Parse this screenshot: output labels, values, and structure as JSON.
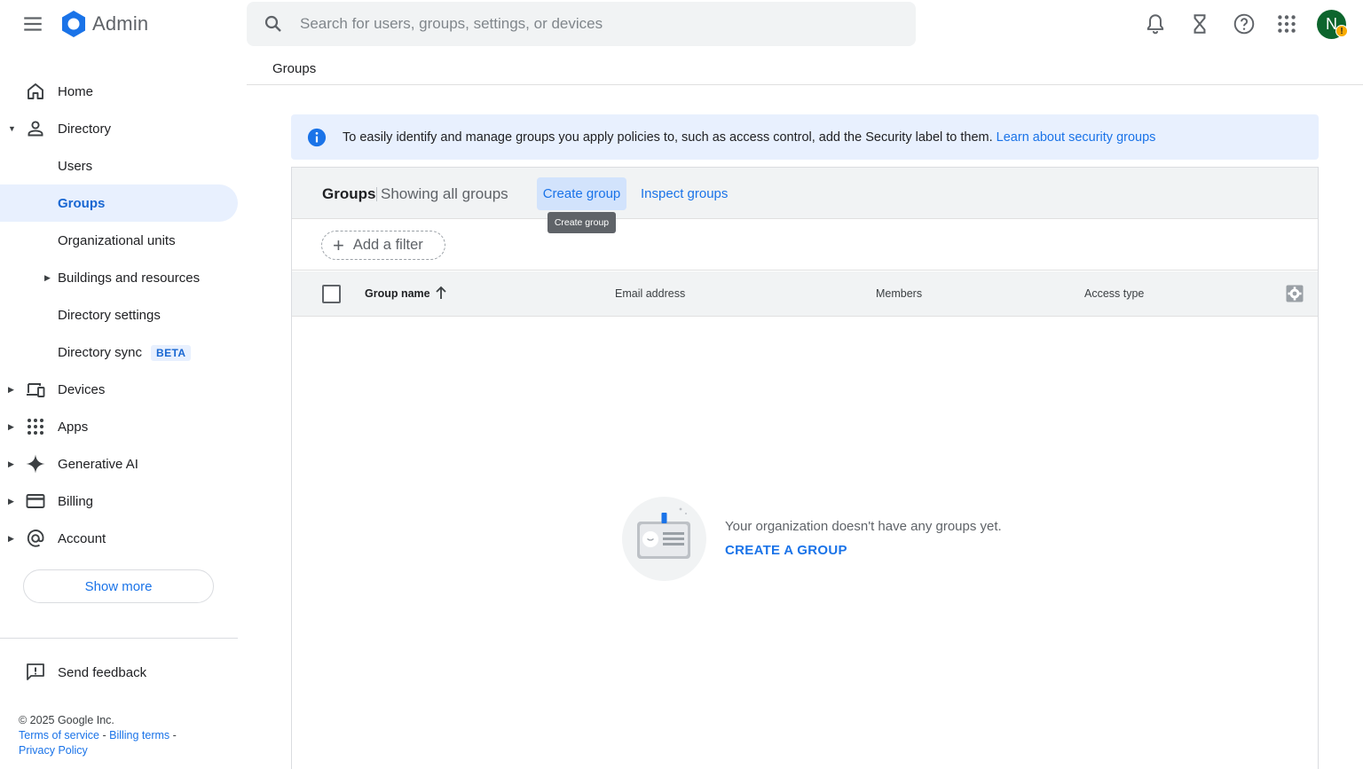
{
  "app": {
    "title": "Admin"
  },
  "search": {
    "placeholder": "Search for users, groups, settings, or devices"
  },
  "header_icons": [
    "menu-icon",
    "bell-icon",
    "hourglass-icon",
    "help-icon",
    "apps-grid-icon"
  ],
  "user": {
    "initial": "N",
    "badge": "!"
  },
  "colors": {
    "accent": "#1a73e8",
    "active_bg": "#e8f0fe",
    "avatar": "#0d652d",
    "warning": "#f9ab00"
  },
  "sidebar": {
    "items": [
      {
        "label": "Home",
        "icon": "home-icon"
      },
      {
        "label": "Directory",
        "icon": "person-icon",
        "expanded": true
      },
      {
        "label": "Users"
      },
      {
        "label": "Groups",
        "active": true
      },
      {
        "label": "Organizational units"
      },
      {
        "label": "Buildings and resources"
      },
      {
        "label": "Directory settings"
      },
      {
        "label": "Directory sync",
        "badge": "BETA"
      },
      {
        "label": "Devices",
        "icon": "devices-icon"
      },
      {
        "label": "Apps",
        "icon": "apps-icon"
      },
      {
        "label": "Generative AI",
        "icon": "sparkle-icon"
      },
      {
        "label": "Billing",
        "icon": "credit-card-icon"
      },
      {
        "label": "Account",
        "icon": "at-sign-icon"
      }
    ],
    "show_more": "Show more",
    "send_feedback": "Send feedback"
  },
  "footer": {
    "copyright": "© 2025 Google Inc.",
    "terms": "Terms of service",
    "billing_terms": "Billing terms",
    "privacy": "Privacy Policy",
    "sep": " - "
  },
  "breadcrumb": {
    "current": "Groups"
  },
  "banner": {
    "text": "To easily identify and manage groups you apply policies to, such as access control, add the Security label to them.",
    "link": "Learn about security groups"
  },
  "card": {
    "title": "Groups",
    "subtitle": "Showing all groups",
    "create_button": "Create group",
    "inspect_button": "Inspect groups",
    "tooltip": "Create group",
    "add_filter": "Add a filter"
  },
  "table": {
    "columns": [
      "Group name",
      "Email address",
      "Members",
      "Access type"
    ],
    "rows": []
  },
  "empty_state": {
    "message": "Your organization doesn't have any groups yet.",
    "action": "CREATE A GROUP"
  }
}
